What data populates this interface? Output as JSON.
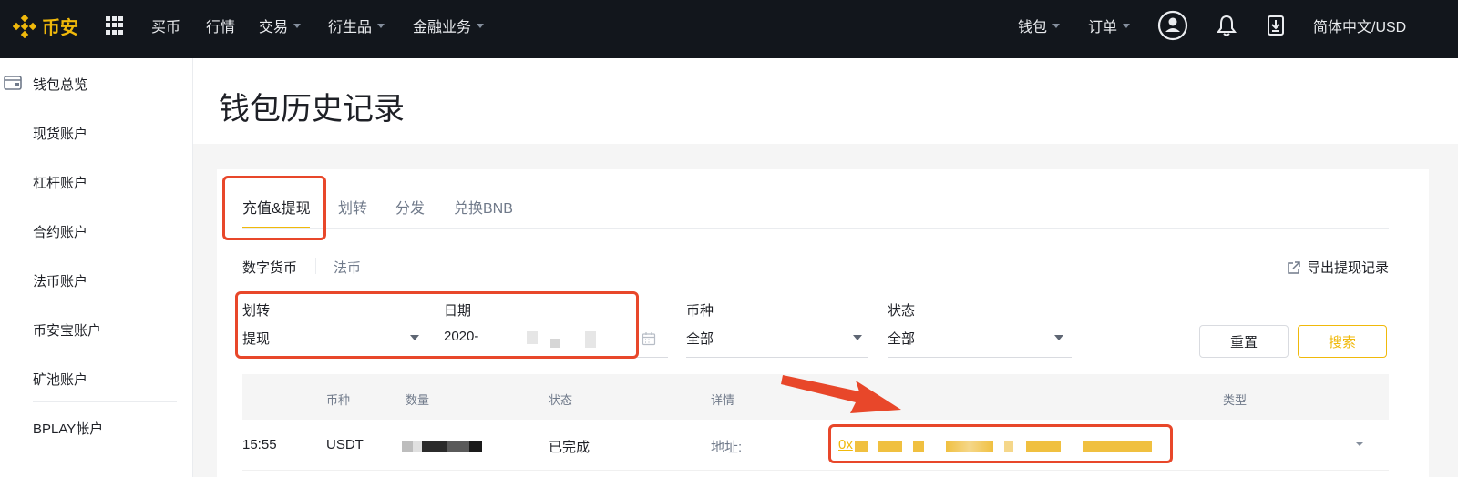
{
  "topbar": {
    "logo_text": "币安",
    "menu_left": [
      {
        "label": "买币",
        "has_caret": false
      },
      {
        "label": "行情",
        "has_caret": false
      },
      {
        "label": "交易",
        "has_caret": true
      },
      {
        "label": "衍生品",
        "has_caret": true
      },
      {
        "label": "金融业务",
        "has_caret": true
      }
    ],
    "menu_right": [
      {
        "label": "钱包",
        "has_caret": true
      },
      {
        "label": "订单",
        "has_caret": true
      }
    ],
    "language_currency": "简体中文/USD",
    "icons": [
      "apps-grid-icon",
      "user-icon",
      "bell-icon",
      "download-icon"
    ]
  },
  "sidebar": {
    "items": [
      {
        "label": "钱包总览",
        "icon": "wallet-icon"
      },
      {
        "label": "现货账户"
      },
      {
        "label": "杠杆账户"
      },
      {
        "label": "合约账户"
      },
      {
        "label": "法币账户"
      },
      {
        "label": "币安宝账户"
      },
      {
        "label": "矿池账户"
      },
      {
        "label": "BPLAY帐户"
      }
    ]
  },
  "page": {
    "title": "钱包历史记录"
  },
  "tabs": [
    {
      "label": "充值&提现",
      "active": true
    },
    {
      "label": "划转",
      "active": false
    },
    {
      "label": "分发",
      "active": false
    },
    {
      "label": "兑换BNB",
      "active": false
    }
  ],
  "subtabs": [
    {
      "label": "数字货币",
      "active": true
    },
    {
      "label": "法币",
      "active": false
    }
  ],
  "export_label": "导出提现记录",
  "filters": {
    "transfer": {
      "label": "划转",
      "value": "提现"
    },
    "date": {
      "label": "日期",
      "value": "2020-"
    },
    "coin": {
      "label": "币种",
      "value": "全部"
    },
    "status": {
      "label": "状态",
      "value": "全部"
    }
  },
  "buttons": {
    "reset": "重置",
    "search": "搜索"
  },
  "table": {
    "headers": [
      "币种",
      "数量",
      "状态",
      "详情",
      "类型"
    ],
    "rows": [
      {
        "time": "15:55",
        "coin": "USDT",
        "status": "已完成",
        "detail_label": "地址:",
        "address_prefix": "0x"
      }
    ]
  },
  "colors": {
    "brand": "#f0b90b",
    "topbar_bg": "#12161c",
    "annotation": "#e8472a"
  }
}
